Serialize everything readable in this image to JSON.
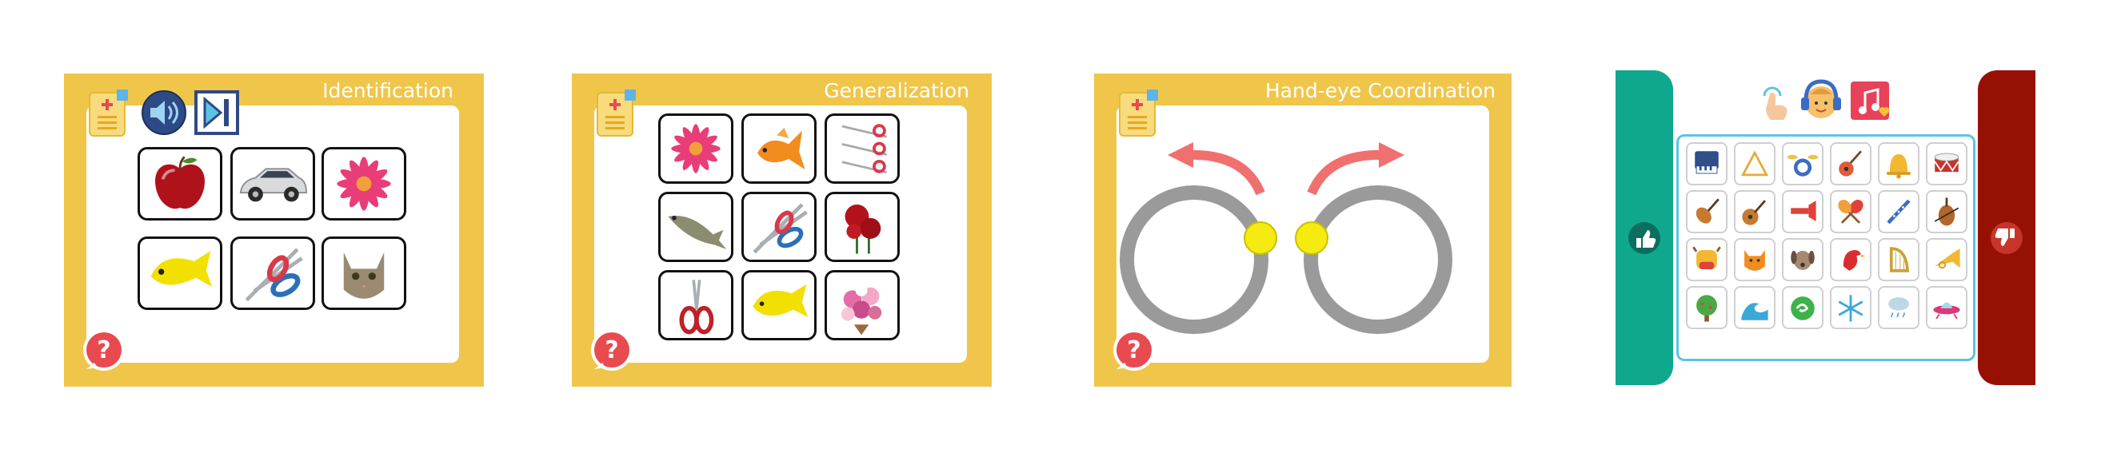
{
  "panels": {
    "identification": {
      "title": "Identification"
    },
    "generalization": {
      "title": "Generalization"
    },
    "hand_eye": {
      "title": "Hand-eye Coordination"
    }
  },
  "icons": {
    "document": "document-plus-icon",
    "speaker": "speaker-icon",
    "skip": "skip-forward-icon",
    "help": "help-question-icon",
    "thumbs_up": "thumbs-up-icon",
    "thumbs_down": "thumbs-down-icon",
    "tap": "hand-tap-icon",
    "listener": "headphones-boy-icon",
    "music": "music-note-heart-icon"
  },
  "identification_items": [
    "apple",
    "car",
    "flower",
    "fish",
    "scissors",
    "cat"
  ],
  "generalization_items": [
    "flower",
    "goldfish",
    "scissors-group",
    "trout",
    "scissors",
    "roses",
    "red-scissors",
    "yellow-fish",
    "bouquet"
  ],
  "sound_grid": [
    [
      "piano",
      "triangle",
      "drum-kit",
      "guitar",
      "bell",
      "snare-drum"
    ],
    [
      "violin",
      "mandolin",
      "trumpet-red",
      "maracas",
      "flute",
      "cello"
    ],
    [
      "cow",
      "cat",
      "dog",
      "bird",
      "harp",
      "horn"
    ],
    [
      "tree",
      "wave",
      "wind",
      "snowflake",
      "rain",
      "ufo"
    ]
  ],
  "colors": {
    "panel_yellow": "#F0C64A",
    "teal": "#0FA88E",
    "dark_red": "#961104",
    "help_red": "#E84A4F",
    "grid_border": "#5BC3E4",
    "ring_gray": "#9a9a9a",
    "arrow_red": "#F07070",
    "ball_yellow": "#F5EB10"
  }
}
